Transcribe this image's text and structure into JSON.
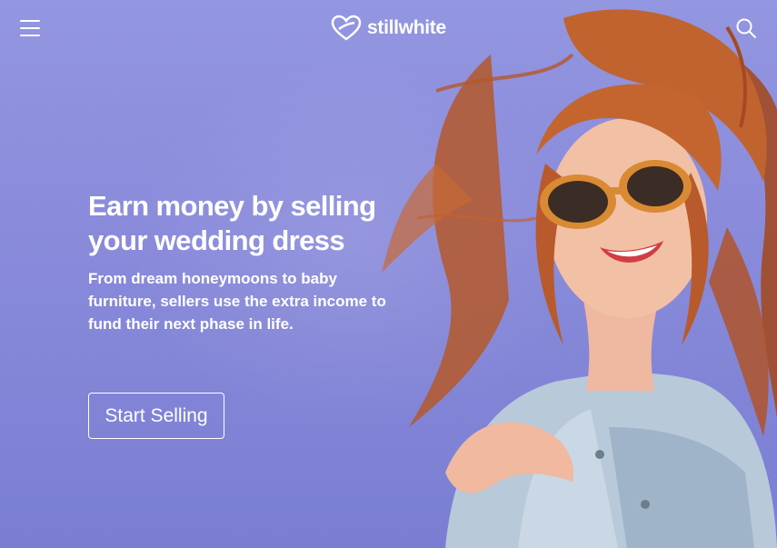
{
  "header": {
    "menu_icon": "hamburger-menu-icon",
    "logo_icon": "heart-logo-icon",
    "brand_name": "stillwhite",
    "search_icon": "search-icon"
  },
  "hero": {
    "headline": "Earn money by selling your wedding dress",
    "subtext": "From dream honeymoons to baby furniture, sellers use the extra income to fund their next phase in life.",
    "cta_label": "Start Selling"
  },
  "colors": {
    "background": "#8a8bdb",
    "text": "#ffffff"
  }
}
